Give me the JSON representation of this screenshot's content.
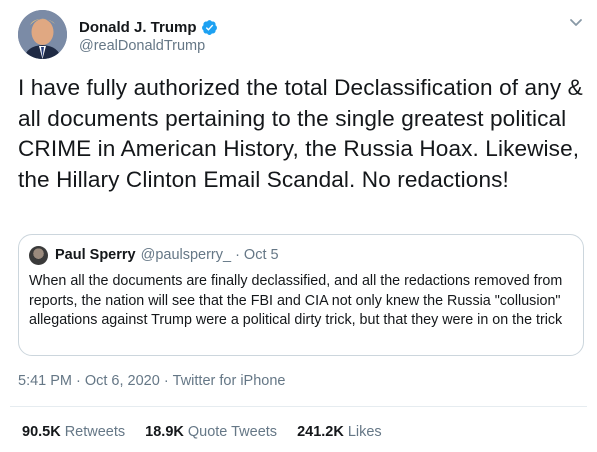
{
  "author": {
    "display_name": "Donald J. Trump",
    "handle": "@realDonaldTrump",
    "verified": true
  },
  "tweet": {
    "text": "I have fully authorized the total Declassification of any & all documents pertaining to the single greatest political CRIME in American History, the Russia Hoax. Likewise, the Hillary Clinton Email Scandal. No redactions!"
  },
  "quoted_tweet": {
    "display_name": "Paul Sperry",
    "handle": "@paulsperry_",
    "separator": "·",
    "date": "Oct 5",
    "text": "When all the documents are finally declassified, and all the redactions removed from reports, the nation will see that the FBI and CIA not only knew the Russia \"collusion\" allegations against Trump were a political dirty trick, but that they were in on the trick"
  },
  "meta": {
    "time": "5:41 PM",
    "sep1": "·",
    "date": "Oct 6, 2020",
    "sep2": "·",
    "source": "Twitter for iPhone"
  },
  "stats": [
    {
      "count": "90.5K",
      "label": "Retweets"
    },
    {
      "count": "18.9K",
      "label": "Quote Tweets"
    },
    {
      "count": "241.2K",
      "label": "Likes"
    }
  ],
  "icons": {
    "verified": "verified-badge-icon",
    "caret": "chevron-down-icon"
  },
  "colors": {
    "verified_blue": "#1da1f2",
    "secondary_text": "#657786",
    "primary_text": "#14171a",
    "border": "#ccd6dd"
  }
}
